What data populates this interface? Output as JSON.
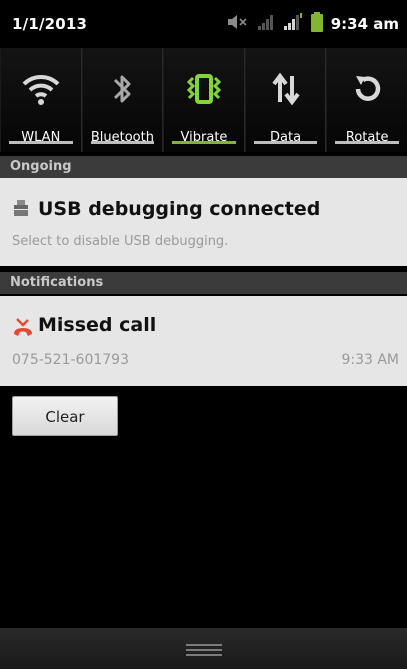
{
  "status_bar": {
    "date": "1/1/2013",
    "time": "9:34 am",
    "icons": [
      "muted-speaker-icon",
      "signal-weak-icon",
      "signal-strong-icon",
      "battery-icon"
    ]
  },
  "quick_settings": [
    {
      "label": "WLAN",
      "icon": "wifi-icon",
      "active": false
    },
    {
      "label": "Bluetooth",
      "icon": "bluetooth-icon",
      "active": false
    },
    {
      "label": "Vibrate",
      "icon": "vibrate-icon",
      "active": true
    },
    {
      "label": "Data",
      "icon": "data-icon",
      "active": false
    },
    {
      "label": "Rotate",
      "icon": "rotate-icon",
      "active": false
    }
  ],
  "ongoing": {
    "header": "Ongoing",
    "title": "USB debugging connected",
    "subtitle": "Select to disable USB debugging.",
    "icon": "usb-icon"
  },
  "notifications": {
    "header": "Notifications",
    "title": "Missed call",
    "number": "075-521-601793",
    "time": "9:33 AM",
    "icon": "missed-call-icon"
  },
  "clear_button": "Clear",
  "colors": {
    "accent": "#84b530",
    "missed_call": "#e24a33",
    "card_bg": "#e6e6e6"
  }
}
